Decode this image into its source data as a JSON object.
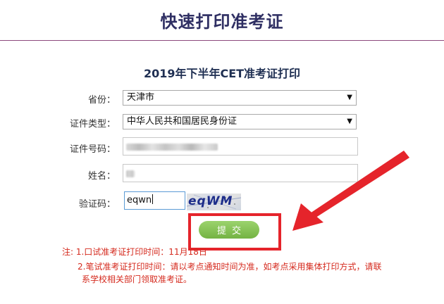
{
  "header": {
    "title": "快速打印准考证"
  },
  "form": {
    "title": "2019年下半年CET准考证打印",
    "province": {
      "label": "省份：",
      "value": "天津市"
    },
    "id_type": {
      "label": "证件类型：",
      "value": "中华人民共和国居民身份证"
    },
    "id_number": {
      "label": "证件号码："
    },
    "name": {
      "label": "姓名："
    },
    "captcha": {
      "label": "验证码：",
      "value": "eqwn",
      "image_text": "eqWM"
    },
    "submit_label": "提交"
  },
  "notes": {
    "line1": "注: 1.口试准考证打印时间：11月18日",
    "line2": "2.笔试准考证打印时间：请以考点通知时间为准，如考点采用集体打印方式，请联",
    "line3": "系学校相关部门领取准考证。"
  },
  "colors": {
    "header_text": "#2f2f63",
    "submit_green": "#74b343",
    "highlight_red": "#e5242b",
    "note_red": "#d52a1e"
  },
  "icons": {
    "select_arrow": "triangle-down-icon"
  }
}
